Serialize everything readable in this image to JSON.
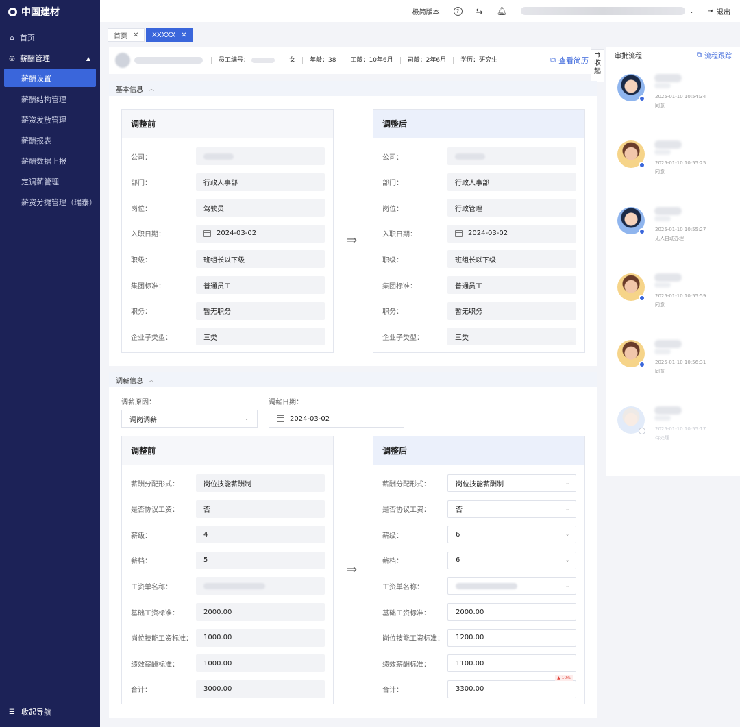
{
  "app": {
    "logo_text": "中国建材"
  },
  "sidebar": {
    "home": "首页",
    "group": "薪酬管理",
    "items": [
      "薪酬设置",
      "薪酬结构管理",
      "薪资发放管理",
      "薪酬报表",
      "薪酬数据上报",
      "定调薪管理",
      "薪资分摊管理（瑞泰）"
    ],
    "active_index": 0,
    "collapse": "收起导航"
  },
  "topbar": {
    "simple_version": "极简版本",
    "help_icon": "question-circle-icon",
    "swap_icon": "swap-icon",
    "bell_icon": "bell-icon",
    "logout": "退出"
  },
  "tabs": [
    {
      "label": "首页",
      "active": false
    },
    {
      "label": "XXXXX",
      "active": true
    }
  ],
  "employee": {
    "id_label": "员工编号：",
    "gender": "女",
    "age": "年龄：38",
    "work_years": "工龄：10年6月",
    "company_years": "司龄：2年6月",
    "education": "学历：研究生",
    "view_resume": "查看简历"
  },
  "collapse_tab": {
    "line1": "收",
    "line2": "起"
  },
  "basic": {
    "title": "基本信息",
    "before_title": "调整前",
    "after_title": "调整后",
    "labels": [
      "公司：",
      "部门：",
      "岗位：",
      "入职日期：",
      "职级：",
      "集团标准：",
      "职务：",
      "企业子类型："
    ],
    "before": [
      "",
      "行政人事部",
      "驾驶员",
      "2024-03-02",
      "班组长以下级",
      "普通员工",
      "暂无职务",
      "三类"
    ],
    "after": [
      "",
      "行政人事部",
      "行政管理",
      "2024-03-02",
      "班组长以下级",
      "普通员工",
      "暂无职务",
      "三类"
    ]
  },
  "salary": {
    "title": "调薪信息",
    "reason_label": "调薪原因：",
    "reason_value": "调岗调薪",
    "date_label": "调薪日期：",
    "date_value": "2024-03-02",
    "before_title": "调整前",
    "after_title": "调整后",
    "labels": [
      "薪酬分配形式：",
      "是否协议工资：",
      "薪级：",
      "薪档：",
      "工资单名称：",
      "基础工资标准：",
      "岗位技能工资标准：",
      "绩效薪酬标准：",
      "合计："
    ],
    "before": [
      "岗位技能薪酬制",
      "否",
      "4",
      "5",
      "",
      "2000.00",
      "1000.00",
      "1000.00",
      "3000.00"
    ],
    "after": [
      "岗位技能薪酬制",
      "否",
      "6",
      "6",
      "",
      "2000.00",
      "1200.00",
      "1100.00",
      "3300.00"
    ],
    "total_badge": "▲ 10%"
  },
  "approval": {
    "title": "审批流程",
    "track": "流程跟踪",
    "steps": [
      {
        "avatar": "female",
        "time": "2025-01-10   10:54:34",
        "status": "同意",
        "pending": false
      },
      {
        "avatar": "male",
        "time": "2025-01-10   10:55:25",
        "status": "同意",
        "pending": false
      },
      {
        "avatar": "female",
        "time": "2025-01-10   10:55:27",
        "status": "无人自动办理",
        "pending": false
      },
      {
        "avatar": "male",
        "time": "2025-01-10   10:55:59",
        "status": "同意",
        "pending": false
      },
      {
        "avatar": "male",
        "time": "2025-01-10   10:56:31",
        "status": "同意",
        "pending": false
      },
      {
        "avatar": "pending",
        "time": "2025-01-10   10:55:17",
        "status": "待处理",
        "pending": true
      }
    ]
  },
  "colors": {
    "sidebar_bg": "#1c2257",
    "accent": "#3a66db"
  }
}
